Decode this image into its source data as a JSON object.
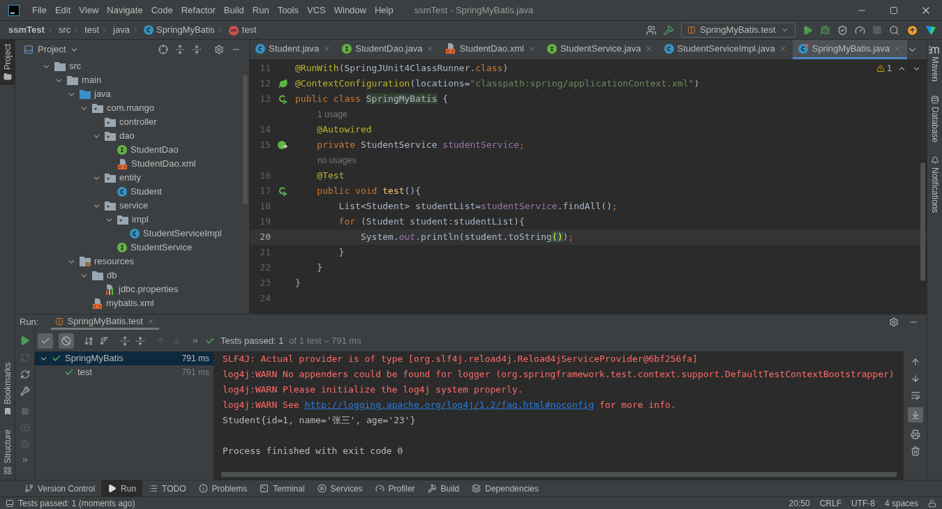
{
  "menu_bar": {
    "items": [
      "File",
      "Edit",
      "View",
      "Navigate",
      "Code",
      "Refactor",
      "Build",
      "Run",
      "Tools",
      "VCS",
      "Window",
      "Help"
    ],
    "title": "ssmTest - SpringMyBatis.java"
  },
  "breadcrumbs": [
    {
      "label": "ssmTest"
    },
    {
      "label": "src"
    },
    {
      "label": "test"
    },
    {
      "label": "java"
    },
    {
      "label": "SpringMyBatis",
      "kind": "class"
    },
    {
      "label": "test",
      "kind": "method"
    }
  ],
  "run_config": "SpringMyBatis.test",
  "left_stripe": [
    {
      "label": "Project",
      "selected": true
    },
    {
      "label": "Bookmarks",
      "selected": false
    },
    {
      "label": "Structure",
      "selected": false
    }
  ],
  "right_stripe": [
    {
      "label": "Maven",
      "kind": "maven"
    },
    {
      "label": "Database",
      "kind": "database"
    },
    {
      "label": "Notifications",
      "kind": "notifications"
    }
  ],
  "project_panel": {
    "title": "Project",
    "tree": [
      {
        "label": "src",
        "kind": "folder",
        "expanded": true,
        "children": [
          {
            "label": "main",
            "kind": "folder",
            "expanded": true,
            "children": [
              {
                "label": "java",
                "kind": "source",
                "expanded": true,
                "children": [
                  {
                    "label": "com.mango",
                    "kind": "package",
                    "expanded": true,
                    "children": [
                      {
                        "label": "controller",
                        "kind": "package"
                      },
                      {
                        "label": "dao",
                        "kind": "package",
                        "expanded": true,
                        "children": [
                          {
                            "label": "StudentDao",
                            "kind": "interface"
                          },
                          {
                            "label": "StudentDao.xml",
                            "kind": "xml"
                          }
                        ]
                      },
                      {
                        "label": "entity",
                        "kind": "package",
                        "expanded": true,
                        "children": [
                          {
                            "label": "Student",
                            "kind": "class"
                          }
                        ]
                      },
                      {
                        "label": "service",
                        "kind": "package",
                        "expanded": true,
                        "children": [
                          {
                            "label": "impl",
                            "kind": "package",
                            "expanded": true,
                            "children": [
                              {
                                "label": "StudentServiceImpl",
                                "kind": "class"
                              }
                            ]
                          },
                          {
                            "label": "StudentService",
                            "kind": "interface"
                          }
                        ]
                      }
                    ]
                  }
                ]
              },
              {
                "label": "resources",
                "kind": "resources",
                "expanded": true,
                "children": [
                  {
                    "label": "db",
                    "kind": "folder",
                    "expanded": true,
                    "children": [
                      {
                        "label": "jdbc.properties",
                        "kind": "properties"
                      }
                    ]
                  },
                  {
                    "label": "mybatis.xml",
                    "kind": "xml"
                  }
                ]
              }
            ]
          }
        ]
      }
    ]
  },
  "editor_tabs": [
    {
      "label": "Student.java",
      "kind": "class",
      "selected": false
    },
    {
      "label": "StudentDao.java",
      "kind": "interface",
      "selected": false
    },
    {
      "label": "StudentDao.xml",
      "kind": "xml",
      "selected": false
    },
    {
      "label": "StudentService.java",
      "kind": "interface",
      "selected": false
    },
    {
      "label": "StudentServiceImpl.java",
      "kind": "class",
      "selected": false
    },
    {
      "label": "SpringMyBatis.java",
      "kind": "test",
      "selected": true
    }
  ],
  "editor": {
    "warning_count": "1",
    "lines": [
      {
        "kind": "code",
        "number": "11",
        "current": false,
        "tokens": [
          {
            "kind": "ann",
            "t": "@RunWith"
          },
          {
            "kind": "plain",
            "t": "(SpringJUnit4ClassRunner."
          },
          {
            "kind": "kw",
            "t": "class"
          },
          {
            "kind": "plain",
            "t": ")"
          }
        ]
      },
      {
        "kind": "code",
        "number": "12",
        "current": false,
        "gutter": {
          "kind": "bean"
        },
        "tokens": [
          {
            "kind": "ann",
            "t": "@ContextConfiguration"
          },
          {
            "kind": "plain",
            "t": "(locations="
          },
          {
            "kind": "str",
            "t": "\"classpath:spring/applicationContext.xml\""
          },
          {
            "kind": "plain",
            "t": ")"
          }
        ]
      },
      {
        "kind": "code",
        "number": "13",
        "current": false,
        "gutter": {
          "kind": "run"
        },
        "tokens": [
          {
            "kind": "kw",
            "t": "public class "
          },
          {
            "kind": "hl",
            "t": "SpringMyBatis"
          },
          {
            "kind": "plain",
            "t": " {"
          }
        ]
      },
      {
        "kind": "hint",
        "text": "1 usage"
      },
      {
        "kind": "code",
        "number": "14",
        "current": false,
        "tokens": [
          {
            "kind": "ann",
            "t": "    @Autowired"
          }
        ]
      },
      {
        "kind": "code",
        "number": "15",
        "current": false,
        "gutter": {
          "kind": "autowired"
        },
        "tokens": [
          {
            "kind": "kw",
            "t": "    private "
          },
          {
            "kind": "plain",
            "t": "StudentService "
          },
          {
            "kind": "field",
            "t": "studentService"
          },
          {
            "kind": "kw",
            "t": ";"
          }
        ]
      },
      {
        "kind": "hint",
        "text": "no usages"
      },
      {
        "kind": "code",
        "number": "16",
        "current": false,
        "tokens": [
          {
            "kind": "ann",
            "t": "    @Test"
          }
        ]
      },
      {
        "kind": "code",
        "number": "17",
        "current": false,
        "gutter": {
          "kind": "run"
        },
        "tokens": [
          {
            "kind": "kw",
            "t": "    public void "
          },
          {
            "kind": "method",
            "t": "test"
          },
          {
            "kind": "plain",
            "t": "(){"
          }
        ]
      },
      {
        "kind": "code",
        "number": "18",
        "current": false,
        "tokens": [
          {
            "kind": "plain",
            "t": "        List<Student> studentList="
          },
          {
            "kind": "field",
            "t": "studentService"
          },
          {
            "kind": "plain",
            "t": ".findAll()"
          },
          {
            "kind": "kw",
            "t": ";"
          }
        ]
      },
      {
        "kind": "code",
        "number": "19",
        "current": false,
        "tokens": [
          {
            "kind": "kw",
            "t": "        for "
          },
          {
            "kind": "plain",
            "t": "(Student student:studentList){"
          }
        ]
      },
      {
        "kind": "code",
        "number": "20",
        "current": true,
        "tokens": [
          {
            "kind": "plain",
            "t": "            System."
          },
          {
            "kind": "static",
            "t": "out"
          },
          {
            "kind": "plain",
            "t": ".println(student.toString"
          },
          {
            "kind": "brace",
            "t": "()"
          },
          {
            "kind": "plain",
            "t": ")"
          },
          {
            "kind": "kw",
            "t": ";"
          }
        ]
      },
      {
        "kind": "code",
        "number": "21",
        "current": false,
        "tokens": [
          {
            "kind": "plain",
            "t": "        }"
          }
        ]
      },
      {
        "kind": "code",
        "number": "22",
        "current": false,
        "tokens": [
          {
            "kind": "plain",
            "t": "    }"
          }
        ]
      },
      {
        "kind": "code",
        "number": "23",
        "current": false,
        "tokens": [
          {
            "kind": "plain",
            "t": "}"
          }
        ]
      },
      {
        "kind": "code",
        "number": "24",
        "current": false
      }
    ]
  },
  "run_panel": {
    "label": "Run:",
    "tab": "SpringMyBatis.test",
    "filters": [
      {
        "kind": "passed",
        "on": true
      },
      {
        "kind": "ignored",
        "on": true
      }
    ],
    "summary": {
      "status": "Tests passed:",
      "count": "1",
      "detail": "of 1 test – 791 ms"
    },
    "tests": [
      {
        "name": "SpringMyBatis",
        "time": "791 ms",
        "passed": true,
        "selected": true,
        "expanded": true,
        "children": [
          {
            "name": "test",
            "time": "791 ms",
            "passed": true,
            "selected": false
          }
        ]
      }
    ],
    "console": [
      {
        "kind": "error",
        "text": "SLF4J: Actual provider is of type [org.slf4j.reload4j.Reload4jServiceProvider@6bf256fa]"
      },
      {
        "kind": "error",
        "text": "log4j:WARN No appenders could be found for logger (org.springframework.test.context.support.DefaultTestContextBootstrapper)"
      },
      {
        "kind": "error",
        "text": "log4j:WARN Please initialize the log4j system properly."
      },
      {
        "kind": "error",
        "text": "log4j:WARN See ",
        "link": "http://logging.apache.org/log4j/1.2/faq.html#noconfig",
        "after": " for more info."
      },
      {
        "kind": "output",
        "text": "Student{id=1, name='张三', age='23'}"
      },
      {
        "kind": "gap"
      },
      {
        "kind": "output",
        "text": "Process finished with exit code 0"
      }
    ]
  },
  "tool_windows": [
    {
      "label": "Version Control",
      "kind": "vcs",
      "selected": false
    },
    {
      "label": "Run",
      "kind": "run",
      "selected": true
    },
    {
      "label": "TODO",
      "kind": "todo",
      "selected": false
    },
    {
      "label": "Problems",
      "kind": "problems",
      "selected": false
    },
    {
      "label": "Terminal",
      "kind": "terminal",
      "selected": false
    },
    {
      "label": "Services",
      "kind": "services",
      "selected": false
    },
    {
      "label": "Profiler",
      "kind": "profiler",
      "selected": false
    },
    {
      "label": "Build",
      "kind": "build",
      "selected": false
    },
    {
      "label": "Dependencies",
      "kind": "dependencies",
      "selected": false
    }
  ],
  "status_bar": {
    "message": "Tests passed: 1 (moments ago)",
    "items": [
      "20:50",
      "CRLF",
      "UTF-8",
      "4 spaces"
    ]
  }
}
